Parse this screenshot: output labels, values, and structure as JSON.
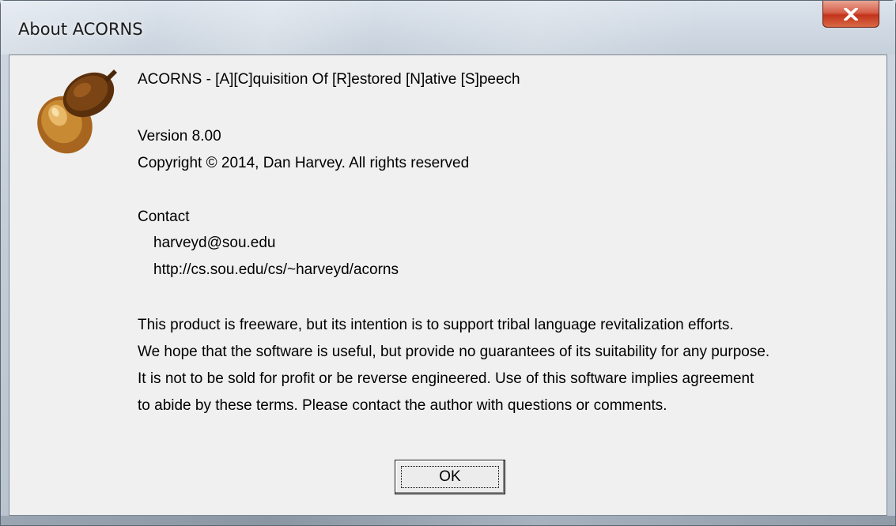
{
  "window": {
    "title": "About ACORNS",
    "close_icon": "close-x-icon"
  },
  "about": {
    "icon": "acorn-icon",
    "product_line": "ACORNS - [A][C]quisition Of [R]estored [N]ative [S]peech",
    "version": "Version 8.00",
    "copyright": "Copyright © 2014, Dan Harvey. All rights reserved",
    "contact_label": "Contact",
    "email": "harveyd@sou.edu",
    "url": "http://cs.sou.edu/cs/~harveyd/acorns",
    "terms": [
      "This product is freeware, but its intention is to support tribal language revitalization efforts.",
      "We hope that the software is useful, but provide no guarantees of its suitability for any purpose.",
      "It is not to be sold for profit or be reverse engineered. Use of this software implies agreement",
      "to abide by these terms. Please contact the author with questions or comments."
    ]
  },
  "buttons": {
    "ok_label": "OK"
  },
  "colors": {
    "dialog_bg": "#f0f0f0",
    "close_red": "#c3331c",
    "acorn_brown": "#8a4a12"
  }
}
